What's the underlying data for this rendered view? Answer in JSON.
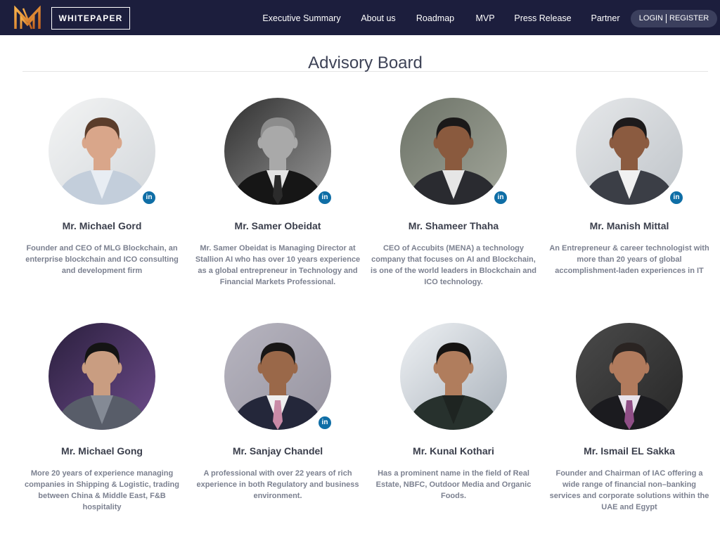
{
  "header": {
    "logo_icon": "brand-logo-icon",
    "whitepaper_label": "WHITEPAPER",
    "nav": [
      "Executive Summary",
      "About us",
      "Roadmap",
      "MVP",
      "Press Release",
      "Partner"
    ],
    "login_label": "LOGIN",
    "register_label": "REGISTER"
  },
  "colors": {
    "header_bg": "#1c1e3d",
    "login_pill_bg": "#3b3f5d",
    "linkedin_blue": "#0f6ea6",
    "title_text": "#3e4357",
    "name_text": "#3b3f4c",
    "description_text": "#7c8190",
    "divider": "#e5e5e5",
    "logo_light": "#f7b04a",
    "logo_dark": "#c4611d",
    "nav_text": "#ffffff"
  },
  "advisory": {
    "title": "Advisory Board",
    "linkedin_label": "in",
    "advisors": [
      {
        "name": "Mr. Michael Gord",
        "description_lines": [
          "Founder and CEO of MLG Blockchain, an",
          "enterprise blockchain and ICO consulting",
          "and development firm"
        ],
        "linkedin": true,
        "photo": {
          "background": "#f3f4f4",
          "background_alt": "#d3d7db",
          "suit": "#c3cedb",
          "shirt": "#e8edf3",
          "tie": null,
          "skin": "#d9a68a",
          "hair": "#5b3d2b"
        }
      },
      {
        "name": "Mr. Samer Obeidat",
        "description_lines": [
          "Mr. Samer Obeidat is Managing Director at",
          "Stallion AI who has over 10 years experience",
          "as a global entrepreneur in Technology and",
          "Financial Markets Professional."
        ],
        "linkedin": true,
        "photo": {
          "background": "#2f2f2f",
          "background_alt": "#9a9a9a",
          "suit": "#161616",
          "shirt": "#e4e4e4",
          "tie": "#2b2b2b",
          "skin": "#a9a9a9",
          "hair": "#8c8c8c"
        }
      },
      {
        "name": "Mr. Shameer Thaha",
        "description_lines": [
          "CEO of Accubits (MENA) a technology",
          "company that focuses on AI and Blockchain,",
          "is one of the world leaders in Blockchain and",
          "ICO technology."
        ],
        "linkedin": true,
        "photo": {
          "background": "#6c7267",
          "background_alt": "#a3a79b",
          "suit": "#2a2b30",
          "shirt": "#e6e6e6",
          "tie": null,
          "skin": "#8a5a3e",
          "hair": "#1b1919"
        }
      },
      {
        "name": "Mr. Manish Mittal",
        "description_lines": [
          "An Entrepreneur & career technologist with",
          "more than 20 years of global",
          "accomplishment-laden experiences in IT"
        ],
        "linkedin": true,
        "photo": {
          "background": "#e6e8ea",
          "background_alt": "#bfc4c9",
          "suit": "#3b3e46",
          "shirt": "#f1f1f1",
          "tie": null,
          "skin": "#8b5b40",
          "hair": "#1c1a1b"
        }
      },
      {
        "name": "Mr. Michael Gong",
        "description_lines": [
          "More 20 years of experience managing",
          "companies in Shipping & Logistic, trading",
          "between China & Middle East, F&B",
          "hospitality"
        ],
        "linkedin": false,
        "photo": {
          "background": "#2a1f3d",
          "background_alt": "#6e4c8c",
          "suit": "#585d69",
          "shirt": "#848a95",
          "tie": null,
          "skin": "#c99d81",
          "hair": "#141414"
        }
      },
      {
        "name": "Mr. Sanjay Chandel",
        "description_lines": [
          "A professional with over 22 years of rich",
          "experience in both Regulatory and business",
          "environment."
        ],
        "linkedin": true,
        "photo": {
          "background": "#b7b5c0",
          "background_alt": "#96939f",
          "suit": "#24273a",
          "shirt": "#efefef",
          "tie": "#c98aa6",
          "skin": "#9a6849",
          "hair": "#181616"
        }
      },
      {
        "name": "Mr. Kunal Kothari",
        "description_lines": [
          "Has a prominent name in the field of Real",
          "Estate, NBFC, Outdoor Media and Organic",
          "Foods."
        ],
        "linkedin": false,
        "photo": {
          "background": "#eef1f4",
          "background_alt": "#a9b1ba",
          "suit": "#27312d",
          "shirt": "#1e2421",
          "tie": null,
          "skin": "#b07d5d",
          "hair": "#151312"
        }
      },
      {
        "name": "Mr. Ismail EL Sakka",
        "description_lines": [
          "Founder and Chairman of IAC offering a",
          "wide range of financial non–banking",
          "services and corporate solutions within the",
          "UAE and Egypt"
        ],
        "linkedin": false,
        "photo": {
          "background": "#4a4a4a",
          "background_alt": "#272727",
          "suit": "#1b1b1f",
          "shirt": "#e8e3eb",
          "tie": "#8f4e86",
          "skin": "#b17b5d",
          "hair": "#2a2422"
        }
      }
    ]
  }
}
